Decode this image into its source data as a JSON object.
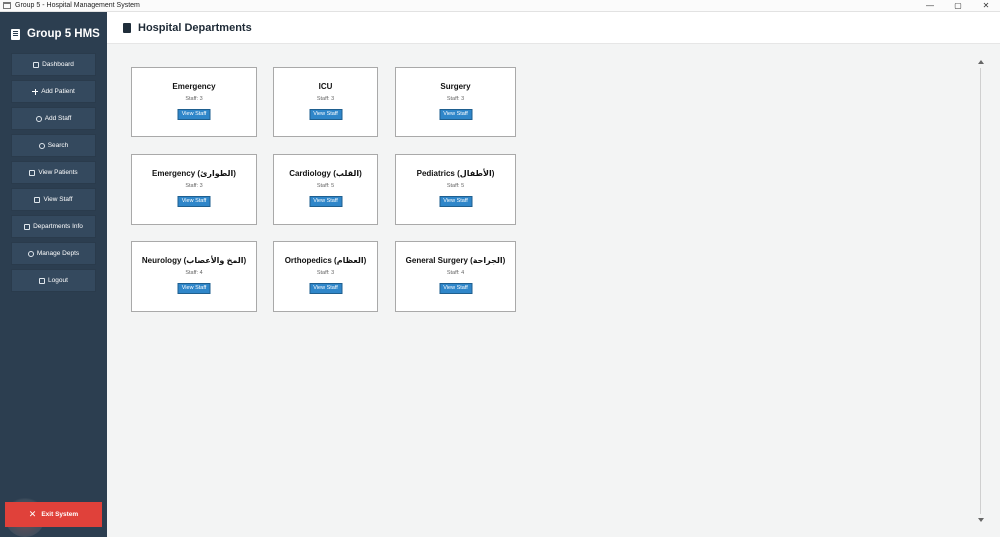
{
  "window": {
    "title": "Group 5 - Hospital Management System",
    "controls": {
      "minimize": "—",
      "maximize": "▢",
      "close": "✕"
    }
  },
  "sidebar": {
    "brand": "Group 5 HMS",
    "items": [
      {
        "label": "Dashboard",
        "icon": "bar-chart-icon"
      },
      {
        "label": "Add Patient",
        "icon": "plus-icon"
      },
      {
        "label": "Add Staff",
        "icon": "staff-icon"
      },
      {
        "label": "Search",
        "icon": "search-icon"
      },
      {
        "label": "View Patients",
        "icon": "clipboard-icon"
      },
      {
        "label": "View Staff",
        "icon": "list-icon"
      },
      {
        "label": "Departments Info",
        "icon": "building-icon"
      },
      {
        "label": "Manage Depts",
        "icon": "gear-icon"
      },
      {
        "label": "Logout",
        "icon": "logout-icon"
      }
    ],
    "exit": "Exit System"
  },
  "header": {
    "title": "Hospital Departments"
  },
  "departments": [
    {
      "name": "Emergency",
      "staff": "Staff: 3",
      "button": "View Staff"
    },
    {
      "name": "ICU",
      "staff": "Staff: 3",
      "button": "View Staff"
    },
    {
      "name": "Surgery",
      "staff": "Staff: 3",
      "button": "View Staff"
    },
    {
      "name": "Emergency (الطوارئ)",
      "staff": "Staff: 3",
      "button": "View Staff"
    },
    {
      "name": "Cardiology (القلب)",
      "staff": "Staff: 5",
      "button": "View Staff"
    },
    {
      "name": "Pediatrics (الأطفال)",
      "staff": "Staff: 5",
      "button": "View Staff"
    },
    {
      "name": "Neurology (المخ والأعصاب)",
      "staff": "Staff: 4",
      "button": "View Staff"
    },
    {
      "name": "Orthopedics (العظام)",
      "staff": "Staff: 3",
      "button": "View Staff"
    },
    {
      "name": "General Surgery (الجراحة)",
      "staff": "Staff: 4",
      "button": "View Staff"
    }
  ],
  "colors": {
    "sidebar_bg": "#2c3e50",
    "nav_button_bg": "#34495e",
    "exit_button_bg": "#e0413a",
    "view_button_bg": "#2f86c9",
    "content_bg": "#f3f4f4"
  }
}
